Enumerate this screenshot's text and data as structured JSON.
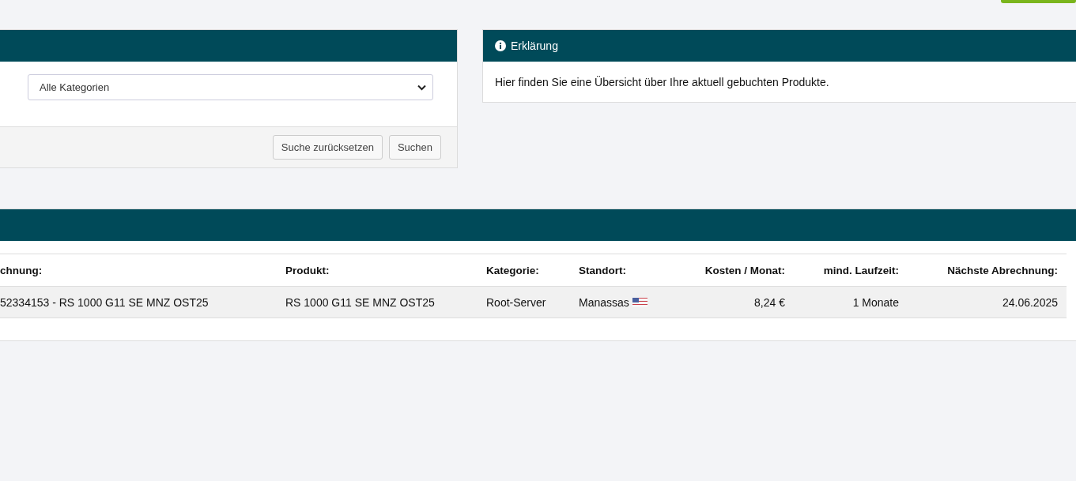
{
  "filter_panel": {
    "category_select": {
      "value": "Alle Kategorien"
    },
    "buttons": [
      "Suche zurücksetzen",
      "Suchen"
    ]
  },
  "info_panel": {
    "title": "Erklärung",
    "text": "Hier finden Sie eine Übersicht über Ihre aktuell gebuchten Produkte."
  },
  "products_table": {
    "columns": [
      "chnung:",
      "Produkt:",
      "Kategorie:",
      "Standort:",
      "Kosten / Monat:",
      "mind. Laufzeit:",
      "Nächste Abrechnung:"
    ],
    "rows": [
      {
        "cells": [
          "52334153 - RS 1000 G11 SE MNZ OST25",
          "RS 1000 G11 SE MNZ OST25",
          "Root-Server",
          "Manassas",
          "8,24 €",
          "1 Monate",
          "24.06.2025"
        ]
      }
    ]
  }
}
